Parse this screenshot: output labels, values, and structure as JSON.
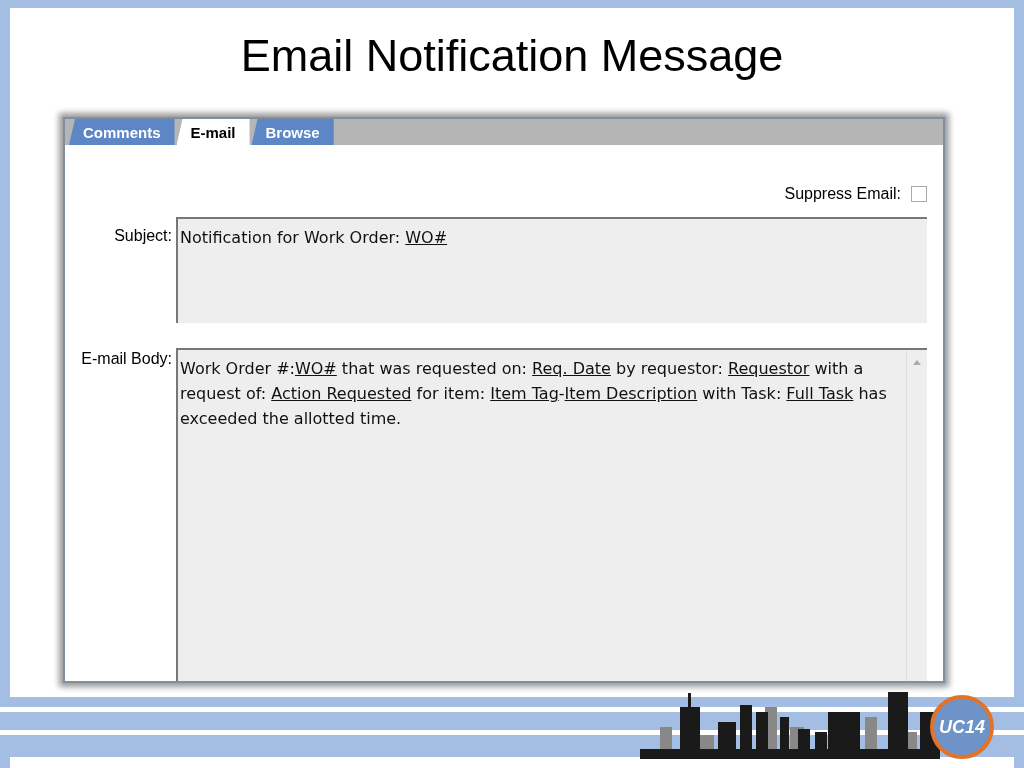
{
  "slide_title": "Email Notification Message",
  "tabs": [
    {
      "label": "Comments",
      "selected": false
    },
    {
      "label": "E-mail",
      "selected": true
    },
    {
      "label": "Browse",
      "selected": false
    }
  ],
  "suppress_email": {
    "label": "Suppress Email:",
    "checked": false
  },
  "subject": {
    "label": "Subject:",
    "segments": [
      {
        "kind": "plain",
        "text": "Notification for Work Order: "
      },
      {
        "kind": "field",
        "text": "WO#"
      }
    ]
  },
  "body": {
    "label": "E-mail Body:",
    "segments": [
      {
        "kind": "plain",
        "text": "Work Order #:"
      },
      {
        "kind": "field",
        "text": "WO#"
      },
      {
        "kind": "plain",
        "text": " that was requested on: "
      },
      {
        "kind": "field",
        "text": "Req. Date"
      },
      {
        "kind": "plain",
        "text": " by requestor: "
      },
      {
        "kind": "field",
        "text": "Requestor"
      },
      {
        "kind": "plain",
        "text": " with a request of: "
      },
      {
        "kind": "field",
        "text": "Action Requested"
      },
      {
        "kind": "plain",
        "text": " for item: "
      },
      {
        "kind": "field",
        "text": "Item Tag"
      },
      {
        "kind": "plain",
        "text": "-"
      },
      {
        "kind": "field",
        "text": "Item Description"
      },
      {
        "kind": "plain",
        "text": " with Task: "
      },
      {
        "kind": "field",
        "text": "Full Task"
      },
      {
        "kind": "plain",
        "text": " has exceeded the allotted time."
      }
    ]
  },
  "logo": {
    "text": "UC14"
  }
}
